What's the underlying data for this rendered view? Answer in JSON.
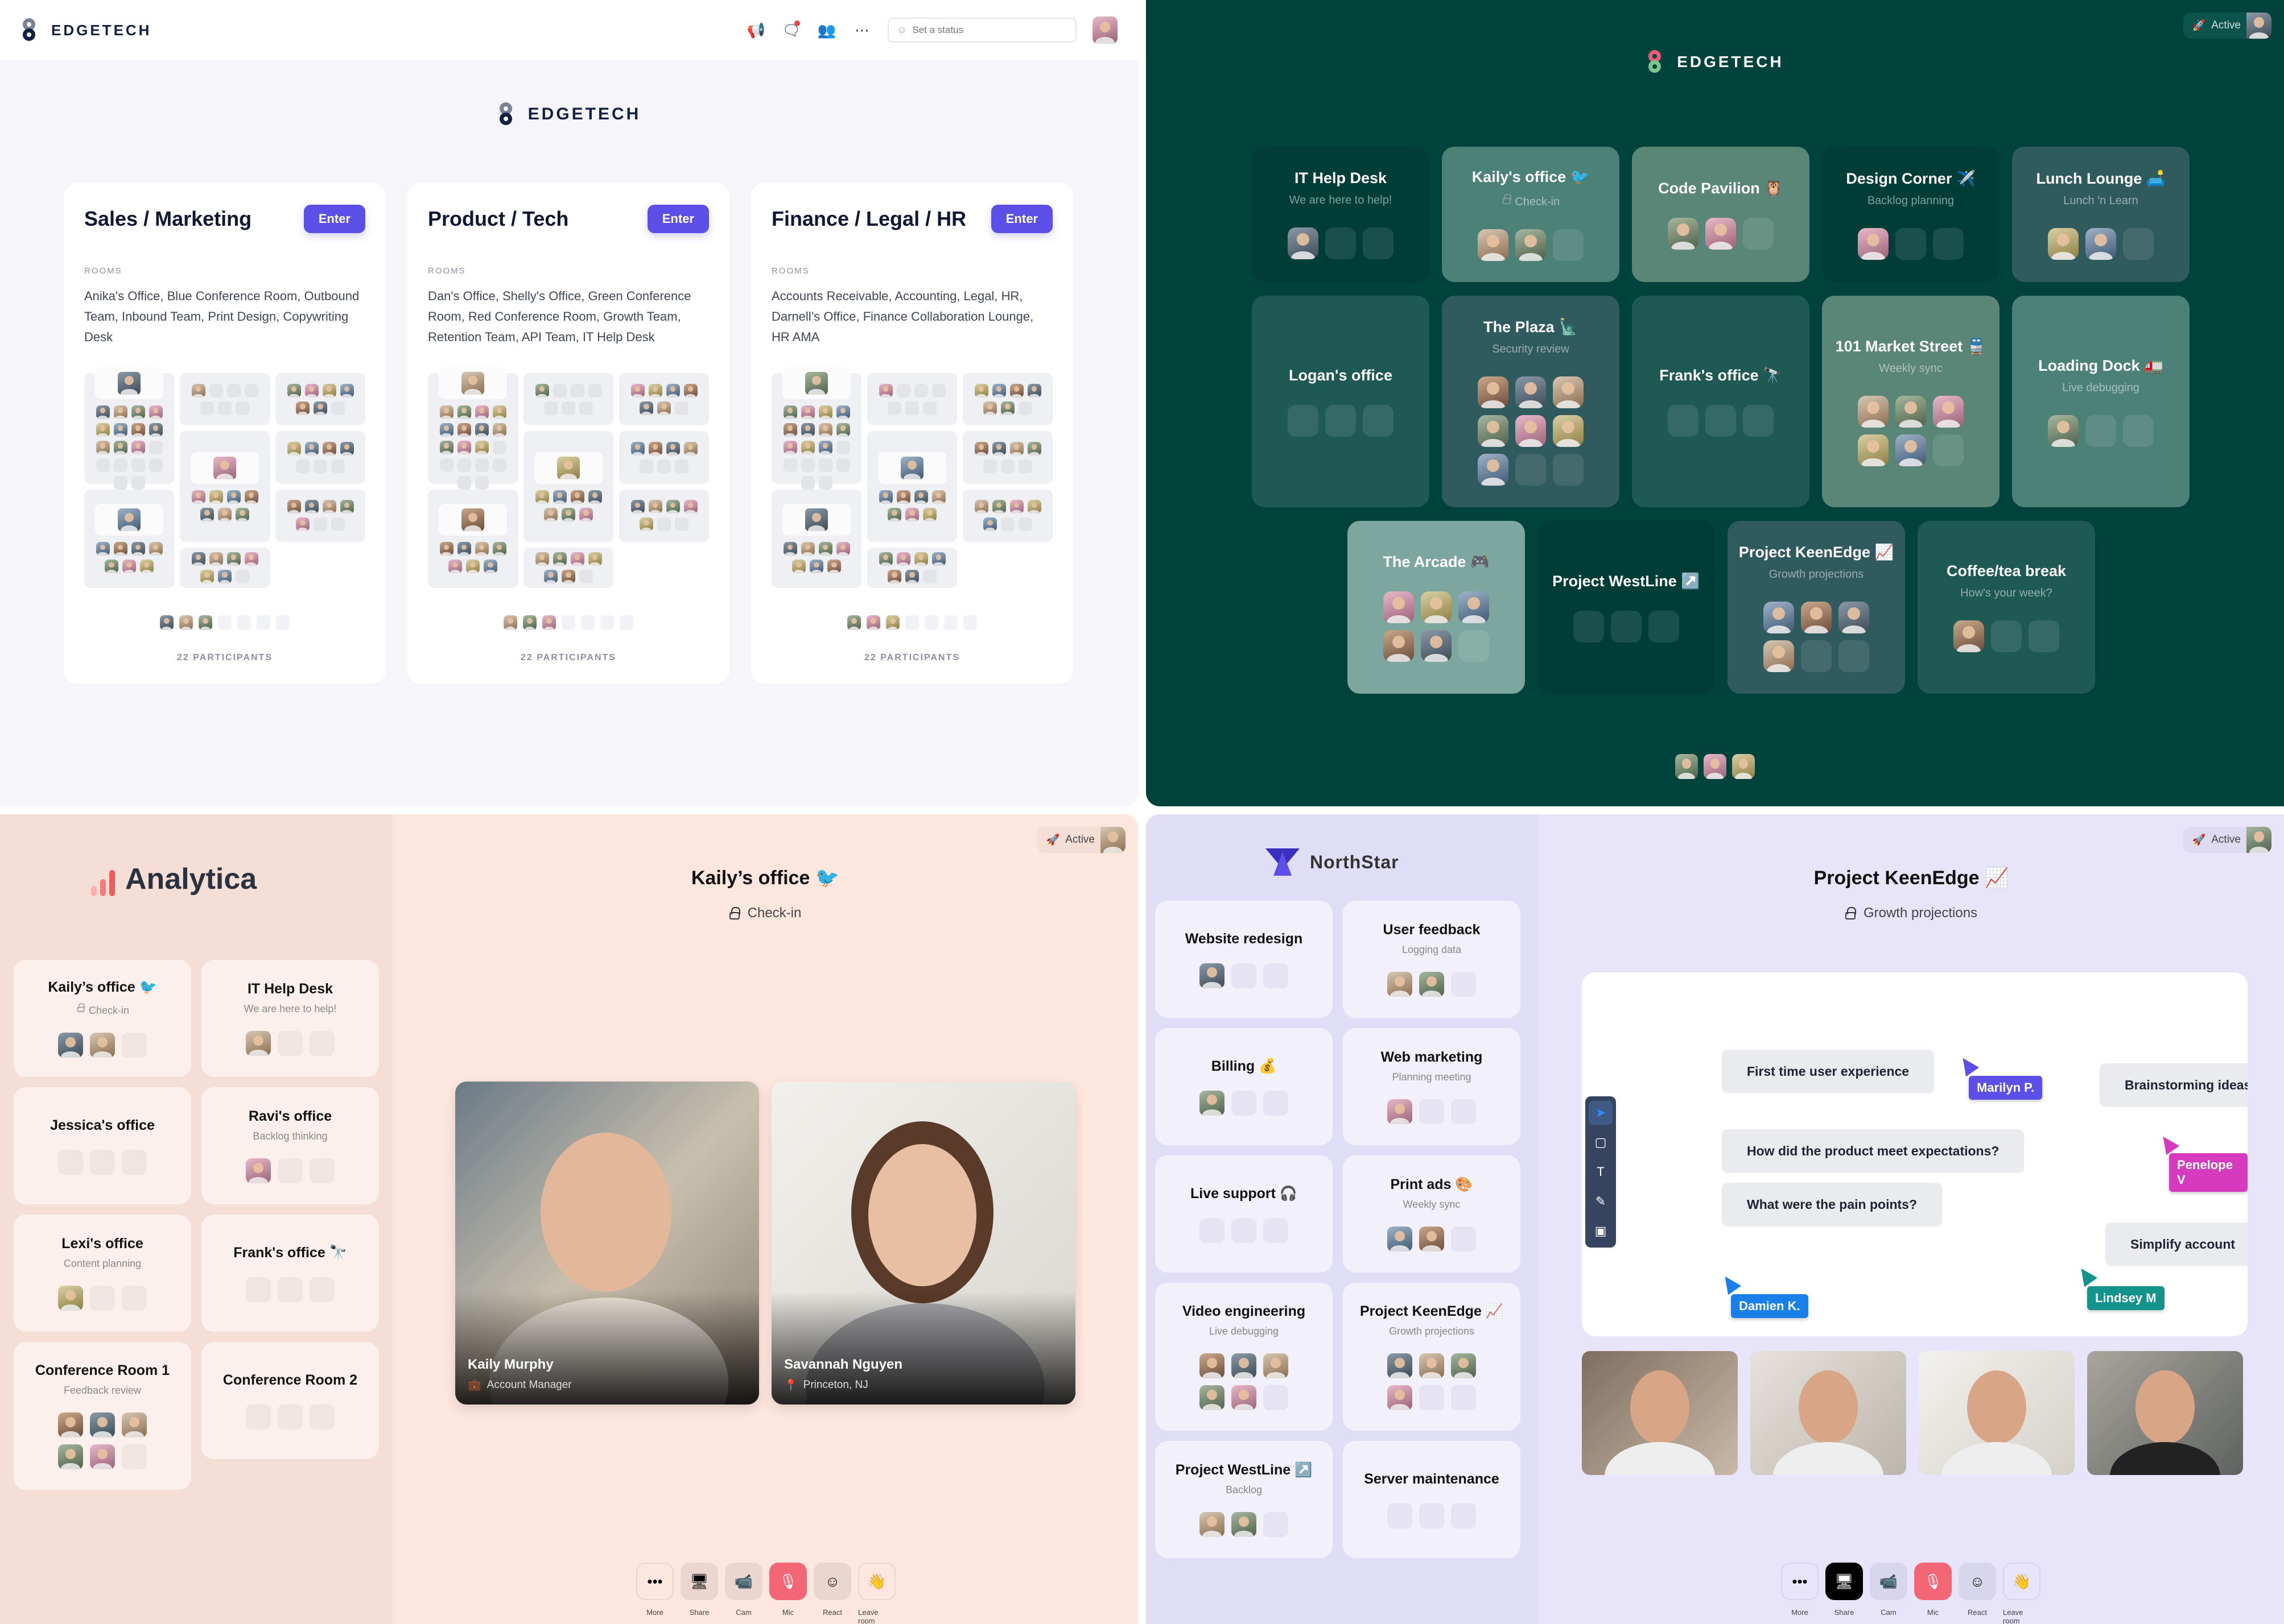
{
  "edgetech_lobby": {
    "brand": "EDGETECH",
    "toolbar_icons": [
      "announcement-icon",
      "chat-icon",
      "people-icon",
      "more-icon"
    ],
    "status_placeholder": "Set a status",
    "center_brand": "EDGETECH",
    "rooms_label": "ROOMS",
    "enter_label": "Enter",
    "spaces": [
      {
        "title": "Sales / Marketing",
        "rooms": "Anika's Office, Blue Conference Room, Outbound Team, Inbound Team, Print Design, Copywriting Desk",
        "participants": "22 PARTICIPANTS"
      },
      {
        "title": "Product / Tech",
        "rooms": "Dan's Office, Shelly's Office, Green Conference Room, Red Conference Room, Growth Team, Retention Team, API Team, IT Help Desk",
        "participants": "22 PARTICIPANTS"
      },
      {
        "title": "Finance / Legal / HR",
        "rooms": "Accounts Receivable, Accounting, Legal, HR, Darnell’s Office, Finance Collaboration Lounge, HR AMA",
        "participants": "22 PARTICIPANTS"
      }
    ]
  },
  "edgetech_floor": {
    "brand": "EDGETECH",
    "status": {
      "emoji": "🚀",
      "label": "Active"
    },
    "rooms": [
      {
        "title": "IT Help Desk",
        "subtitle": "We are here to help!",
        "people": 1,
        "slots": 3
      },
      {
        "title": "Kaily's office 🐦",
        "subtitle": "Check-in",
        "locked": true,
        "people": 2,
        "slots": 3
      },
      {
        "title": "Code Pavilion 🦉",
        "subtitle": "",
        "people": 2,
        "slots": 3
      },
      {
        "title": "Design Corner ✈️",
        "subtitle": "Backlog planning",
        "people": 1,
        "slots": 3
      },
      {
        "title": "Lunch Lounge 🛋️",
        "subtitle": "Lunch 'n Learn",
        "people": 2,
        "slots": 3
      },
      {
        "title": "Logan's office",
        "subtitle": "",
        "people": 0,
        "slots": 3
      },
      {
        "title": "The Plaza 🗽",
        "subtitle": "Security review",
        "people": 7,
        "slots": 9
      },
      {
        "title": "Frank's office 🔭",
        "subtitle": "",
        "people": 0,
        "slots": 3
      },
      {
        "title": "101 Market Street 🚆",
        "subtitle": "Weekly sync",
        "people": 5,
        "slots": 6
      },
      {
        "title": "Loading Dock 🚛",
        "subtitle": "Live debugging",
        "people": 1,
        "slots": 3
      },
      {
        "title": "The Arcade 🎮",
        "subtitle": "",
        "people": 5,
        "slots": 6
      },
      {
        "title": "Project WestLine ↗️",
        "subtitle": "",
        "people": 0,
        "slots": 3
      },
      {
        "title": "Project KeenEdge 📈",
        "subtitle": "Growth projections",
        "people": 4,
        "slots": 6
      },
      {
        "title": "Coffee/tea break",
        "subtitle": "How's your week?",
        "people": 1,
        "slots": 3
      }
    ],
    "online_count_avatars": 3
  },
  "analytica": {
    "brand": "Analytica",
    "status": {
      "emoji": "🚀",
      "label": "Active"
    },
    "rooms": [
      {
        "title": "Kaily’s office 🐦",
        "subtitle": "Check-in",
        "locked": true,
        "people": 2,
        "slots": 3
      },
      {
        "title": "IT Help Desk",
        "subtitle": "We are here to help!",
        "people": 1,
        "slots": 3
      },
      {
        "title": "Jessica's office",
        "subtitle": "",
        "people": 0,
        "slots": 3
      },
      {
        "title": "Ravi's office",
        "subtitle": "Backlog thinking",
        "people": 1,
        "slots": 3
      },
      {
        "title": "Lexi's office",
        "subtitle": "Content planning",
        "people": 1,
        "slots": 3
      },
      {
        "title": "Frank's office 🔭",
        "subtitle": "",
        "people": 0,
        "slots": 3
      },
      {
        "title": "Conference Room 1",
        "subtitle": "Feedback review",
        "people": 5,
        "slots": 6
      },
      {
        "title": "Conference Room 2",
        "subtitle": "",
        "people": 0,
        "slots": 3
      }
    ],
    "current_room": {
      "title": "Kaily’s office 🐦",
      "subtitle": "Check-in"
    },
    "participants": [
      {
        "name": "Kaily Murphy",
        "meta": "Account Manager",
        "meta_icon": "briefcase-icon"
      },
      {
        "name": "Savannah Nguyen",
        "meta": "Princeton, NJ",
        "meta_icon": "location-pin-icon"
      }
    ],
    "controls": [
      {
        "label": "More",
        "icon": "•••",
        "state": "default"
      },
      {
        "label": "Share",
        "icon": "🖥",
        "state": "tinted"
      },
      {
        "label": "Cam",
        "icon": "📹",
        "state": "tinted"
      },
      {
        "label": "Mic",
        "icon": "🎙",
        "state": "muted"
      },
      {
        "label": "React",
        "icon": "☺",
        "state": "tinted"
      },
      {
        "label": "Leave room",
        "icon": "👋",
        "state": "default"
      }
    ]
  },
  "northstar": {
    "brand": "NorthStar",
    "status": {
      "emoji": "🚀",
      "label": "Active"
    },
    "rooms": [
      {
        "title": "Website redesign",
        "subtitle": "",
        "people": 1,
        "slots": 3
      },
      {
        "title": "User feedback",
        "subtitle": "Logging data",
        "people": 2,
        "slots": 3
      },
      {
        "title": "Billing 💰",
        "subtitle": "",
        "people": 1,
        "slots": 3
      },
      {
        "title": "Web marketing",
        "subtitle": "Planning meeting",
        "people": 1,
        "slots": 3
      },
      {
        "title": "Live support 🎧",
        "subtitle": "",
        "people": 0,
        "slots": 3
      },
      {
        "title": "Print ads 🎨",
        "subtitle": "Weekly sync",
        "people": 2,
        "slots": 3
      },
      {
        "title": "Video engineering",
        "subtitle": "Live debugging",
        "people": 5,
        "slots": 6
      },
      {
        "title": "Project KeenEdge 📈",
        "subtitle": "Growth projections",
        "people": 4,
        "slots": 6
      },
      {
        "title": "Project WestLine ↗️",
        "subtitle": "Backlog",
        "people": 2,
        "slots": 3
      },
      {
        "title": "Server maintenance",
        "subtitle": "",
        "people": 0,
        "slots": 3
      }
    ],
    "current_room": {
      "title": "Project KeenEdge 📈",
      "subtitle": "Growth projections"
    },
    "whiteboard": {
      "notes": [
        "First time user experience",
        "Brainstorming ideas",
        "How did the product meet expectations?",
        "What were the pain points?",
        "Simplify account"
      ],
      "cursors": [
        {
          "name": "Marilyn P.",
          "color": "#5b4fe8"
        },
        {
          "name": "Penelope V",
          "color": "#d63bbf"
        },
        {
          "name": "Damien K.",
          "color": "#1a7fe8"
        },
        {
          "name": "Lindsey M",
          "color": "#13938b"
        }
      ],
      "tools": [
        "select-tool",
        "rectangle-tool",
        "text-tool",
        "pen-tool",
        "image-tool"
      ],
      "active_tool": "select-tool"
    },
    "video_feeds": 4,
    "controls": [
      {
        "label": "More",
        "icon": "•••",
        "state": "default"
      },
      {
        "label": "Share",
        "icon": "🖥",
        "state": "active"
      },
      {
        "label": "Cam",
        "icon": "📹",
        "state": "tinted"
      },
      {
        "label": "Mic",
        "icon": "🎙",
        "state": "muted"
      },
      {
        "label": "React",
        "icon": "☺",
        "state": "tinted"
      },
      {
        "label": "Leave room",
        "icon": "👋",
        "state": "default"
      }
    ]
  }
}
